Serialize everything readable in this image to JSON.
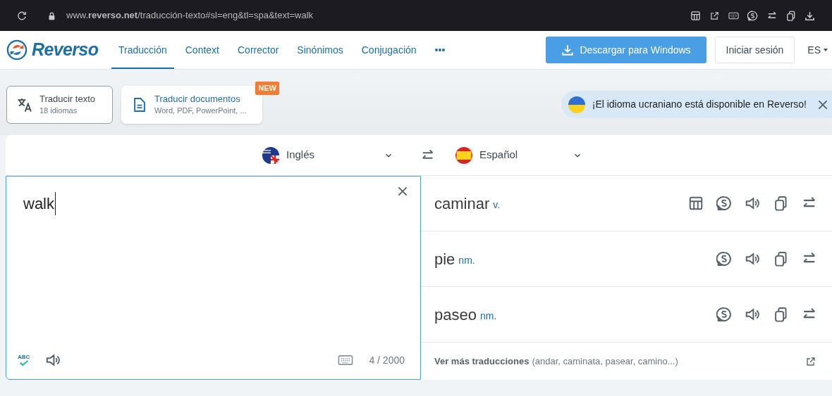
{
  "browser": {
    "url": "www.**reverso.net**/traducción-texto#sl=eng&tl=spa&text=walk"
  },
  "header": {
    "logo": "Reverso",
    "nav": [
      {
        "label": "Traducción",
        "selected": true
      },
      {
        "label": "Context",
        "selected": false
      },
      {
        "label": "Corrector",
        "selected": false
      },
      {
        "label": "Sinónimos",
        "selected": false
      },
      {
        "label": "Conjugación",
        "selected": false
      },
      {
        "label": "•••",
        "selected": false
      }
    ],
    "download_button": "Descargar para Windows",
    "login_button": "Iniciar sesión",
    "language": "ES"
  },
  "modes": [
    {
      "title": "Traducir texto",
      "subtitle": "18 idiomas",
      "selected": true
    },
    {
      "title": "Traducir documentos",
      "subtitle": "Word, PDF, PowerPoint, ...",
      "selected": false,
      "badge": "NEW"
    }
  ],
  "banner": {
    "text": "¡El idioma ucraniano está disponible en Reverso!"
  },
  "source_language": "Inglés",
  "target_language": "Español",
  "input": {
    "value": "walk",
    "spellcheck": "ABC",
    "counter": "4 / 2000"
  },
  "translations": [
    {
      "word": "caminar",
      "pos": "v.",
      "conjugation": true
    },
    {
      "word": "pie",
      "pos": "nm.",
      "conjugation": false
    },
    {
      "word": "paseo",
      "pos": "nm.",
      "conjugation": false
    }
  ],
  "more": {
    "label": "Ver más traducciones",
    "examples": "(andar, caminata, pasear, camino...)"
  }
}
